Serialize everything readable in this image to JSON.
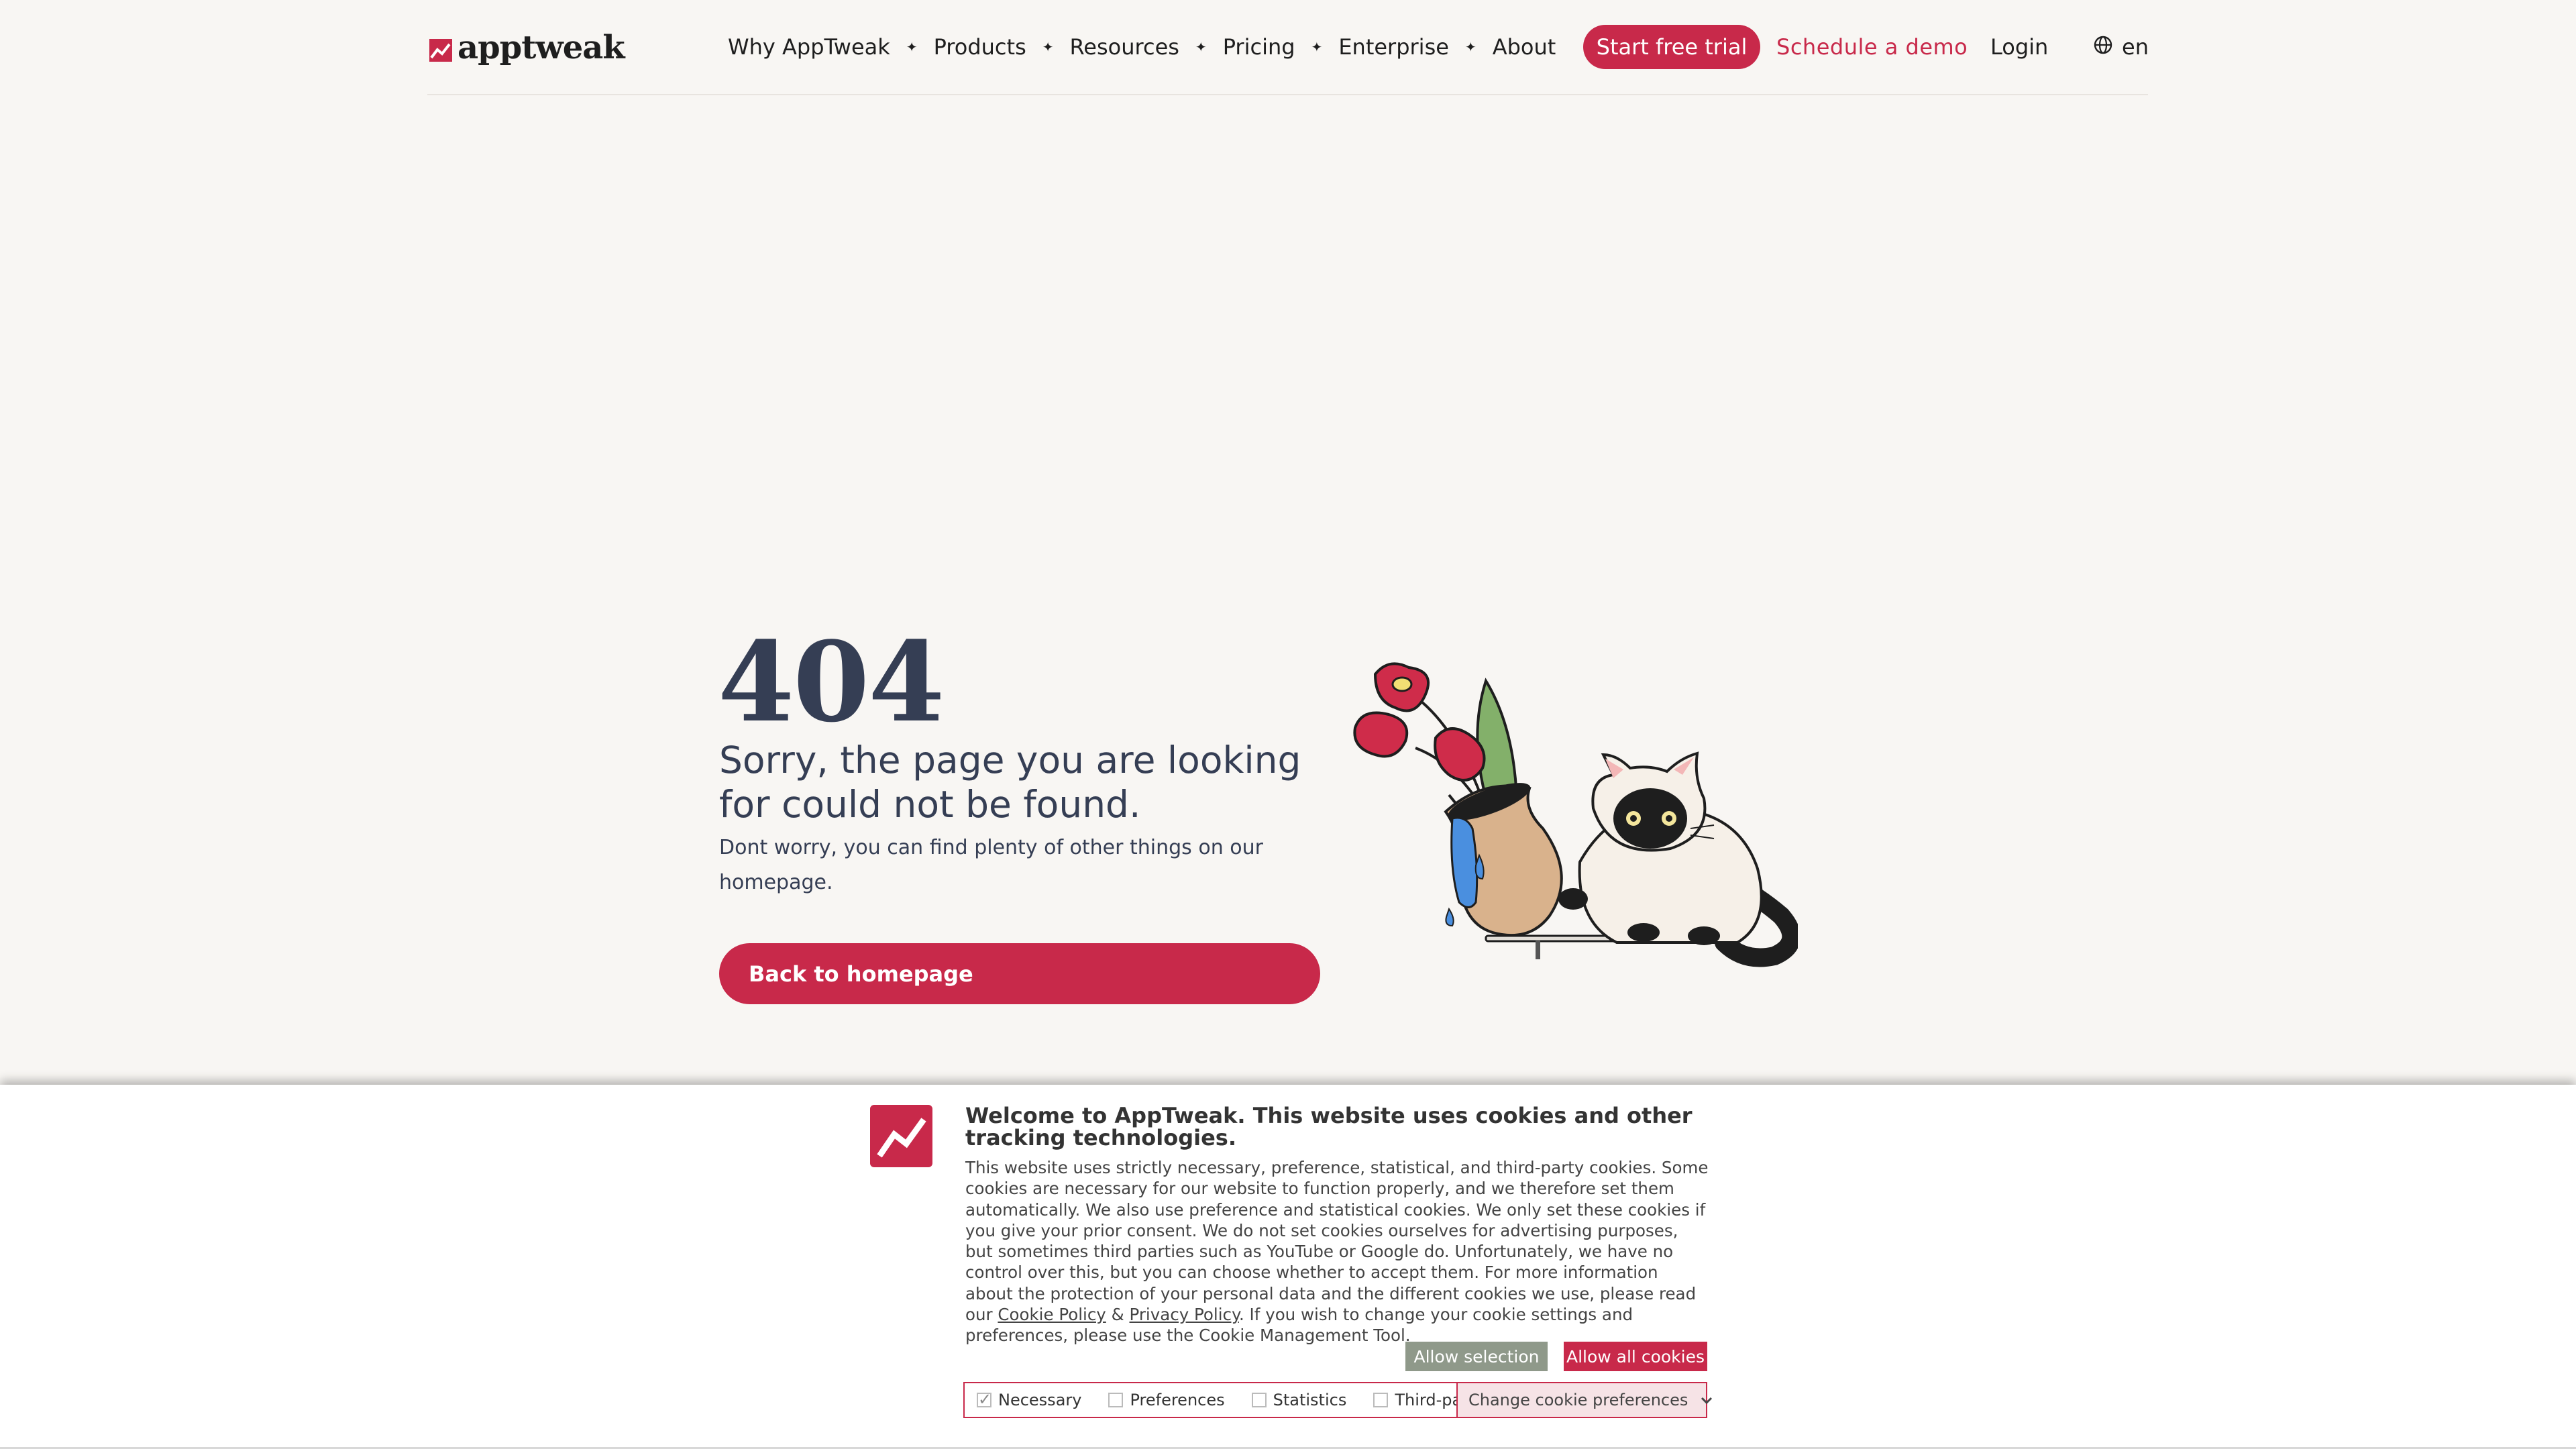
{
  "header": {
    "logo_text": "apptweak",
    "nav": [
      "Why AppTweak",
      "Products",
      "Resources",
      "Pricing",
      "Enterprise",
      "About"
    ],
    "separator": "✦",
    "trial_label": "Start free trial",
    "demo_label": "Schedule a demo",
    "login_label": "Login",
    "lang_label": "en"
  },
  "error": {
    "code": "404",
    "title": "Sorry, the page you are looking for could not be found.",
    "description": "Dont worry, you can find plenty of other things on our homepage.",
    "button_label": "Back to homepage"
  },
  "cookie": {
    "title": "Welcome to AppTweak. This website uses cookies and other tracking technologies.",
    "body_part1": "This website uses strictly necessary, preference, statistical, and third-party cookies. Some cookies are necessary for our website to function properly, and we therefore set them automatically. We also use preference and statistical cookies. We only set these cookies if you give your prior consent. We do not set cookies ourselves for advertising purposes, but sometimes third parties such as YouTube or Google do. Unfortunately, we have no control over this, but you can choose whether to accept them. For more information about the protection of your personal data and the different cookies we use, please read our ",
    "cookie_policy_link": "Cookie Policy",
    "and_text": " & ",
    "privacy_policy_link": "Privacy Policy",
    "body_part2": ". If you wish to change your cookie settings and preferences, please use the Cookie Management Tool.",
    "allow_selection_label": "Allow selection",
    "allow_all_label": "Allow all cookies",
    "options": [
      {
        "label": "Necessary",
        "checked": true
      },
      {
        "label": "Preferences",
        "checked": false
      },
      {
        "label": "Statistics",
        "checked": false
      },
      {
        "label": "Third-party",
        "checked": false
      }
    ],
    "change_label": "Change cookie preferences"
  },
  "colors": {
    "brand": "#c8294a",
    "heading": "#353e54",
    "background": "#f8f6f3"
  }
}
